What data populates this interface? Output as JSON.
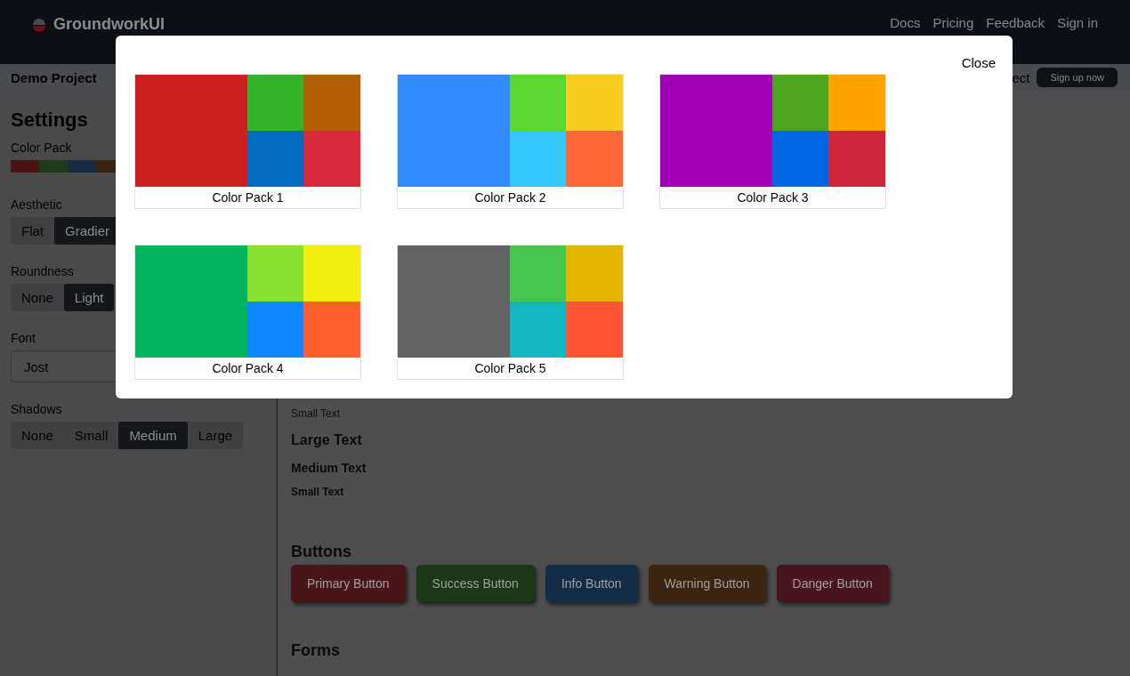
{
  "header": {
    "brand": "GroundworkUI",
    "nav_links": [
      "Docs",
      "Pricing",
      "Feedback",
      "Sign in"
    ]
  },
  "subheader": {
    "project": "Demo Project",
    "partial_text": "ect",
    "signup_button": "Sign up now"
  },
  "sidebar": {
    "title": "Settings",
    "color_pack": {
      "label": "Color Pack",
      "swatches": [
        {
          "color": "#4a1414"
        },
        {
          "color": "#1d3a19"
        },
        {
          "color": "#172c44"
        },
        {
          "color": "#3a2410"
        }
      ]
    },
    "aesthetic": {
      "label": "Aesthetic",
      "options": [
        {
          "label": "Flat",
          "selected": false
        },
        {
          "label": "Gradier",
          "selected": true
        }
      ]
    },
    "roundness": {
      "label": "Roundness",
      "options": [
        {
          "label": "None",
          "selected": false
        },
        {
          "label": "Light",
          "selected": true
        }
      ]
    },
    "font": {
      "label": "Font",
      "value": "Jost"
    },
    "shadows": {
      "label": "Shadows",
      "options": [
        {
          "label": "None",
          "selected": false
        },
        {
          "label": "Small",
          "selected": false
        },
        {
          "label": "Medium",
          "selected": true
        },
        {
          "label": "Large",
          "selected": false
        }
      ]
    }
  },
  "content": {
    "texts": [
      {
        "kind": "plain",
        "text": "Small Text"
      },
      {
        "kind": "large",
        "text": "Large Text"
      },
      {
        "kind": "medium",
        "text": "Medium Text"
      },
      {
        "kind": "small",
        "text": "Small Text"
      }
    ],
    "buttons_heading": "Buttons",
    "buttons": [
      {
        "label": "Primary Button",
        "color": "#4a1519"
      },
      {
        "label": "Success Button",
        "color": "#1b3718"
      },
      {
        "label": "Info Button",
        "color": "#122d48"
      },
      {
        "label": "Warning Button",
        "color": "#3b2410"
      },
      {
        "label": "Danger Button",
        "color": "#48151f"
      }
    ],
    "forms_heading": "Forms"
  },
  "modal": {
    "close": "Close",
    "packs": [
      {
        "name": "Color Pack 1",
        "swatches": [
          {
            "color": "#cb1f1f"
          },
          {
            "color": "#33b32a"
          },
          {
            "color": "#b35f06"
          },
          {
            "color": "#006bbf"
          },
          {
            "color": "#d92a3e"
          }
        ]
      },
      {
        "name": "Color Pack 2",
        "swatches": [
          {
            "color": "#338cff"
          },
          {
            "color": "#5cd631"
          },
          {
            "color": "#f8cd22"
          },
          {
            "color": "#36c8fb"
          },
          {
            "color": "#ff6638"
          }
        ]
      },
      {
        "name": "Color Pack 3",
        "swatches": [
          {
            "color": "#a000b3"
          },
          {
            "color": "#4ea51f"
          },
          {
            "color": "#ffa300"
          },
          {
            "color": "#0068e2"
          },
          {
            "color": "#d0263b"
          }
        ]
      },
      {
        "name": "Color Pack 4",
        "swatches": [
          {
            "color": "#00b35c"
          },
          {
            "color": "#88e030"
          },
          {
            "color": "#f2ef10"
          },
          {
            "color": "#0f87ff"
          },
          {
            "color": "#ff5f2c"
          }
        ]
      },
      {
        "name": "Color Pack 5",
        "swatches": [
          {
            "color": "#636363"
          },
          {
            "color": "#45c64c"
          },
          {
            "color": "#e2b500"
          },
          {
            "color": "#12b6c2"
          },
          {
            "color": "#ff5534"
          }
        ]
      }
    ]
  }
}
